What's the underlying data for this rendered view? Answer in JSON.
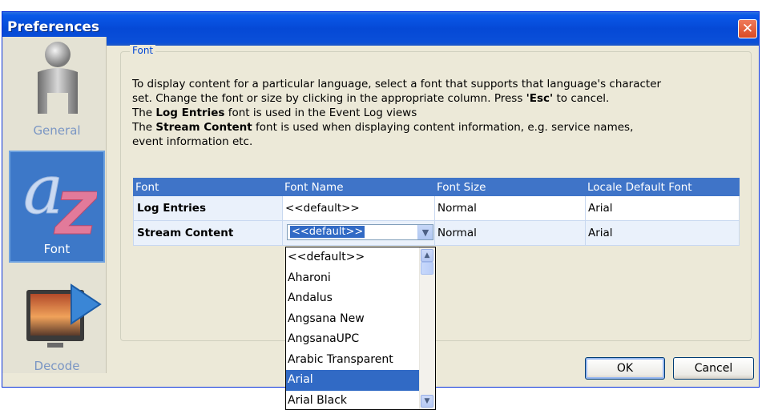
{
  "window": {
    "title": "Preferences",
    "close_glyph": "✕"
  },
  "sidebar": {
    "items": [
      {
        "label": "General",
        "icon": "person-icon",
        "selected": false
      },
      {
        "label": "Font",
        "icon": "font-az-icon",
        "selected": true
      },
      {
        "label": "Decode",
        "icon": "tv-play-icon",
        "selected": false
      }
    ]
  },
  "group": {
    "legend": "Font",
    "lines": [
      {
        "pre": "To display content for a particular language, select a font that supports that language's character",
        "bold": "",
        "post": ""
      },
      {
        "pre": "set. Change the font or size by clicking in the appropriate column. Press ",
        "bold": "'Esc'",
        "post": " to cancel."
      },
      {
        "pre": "The ",
        "bold": "Log Entries",
        "post": " font is used in the Event Log views"
      },
      {
        "pre": "The ",
        "bold": "Stream Content",
        "post": " font is used when displaying content information, e.g. service names,"
      },
      {
        "pre": "event information etc.",
        "bold": "",
        "post": ""
      }
    ]
  },
  "table": {
    "headers": [
      "Font",
      "Font Name",
      "Font Size",
      "Locale Default Font"
    ],
    "rows": [
      {
        "font": "Log Entries",
        "name": "<<default>>",
        "size": "Normal",
        "locale": "Arial"
      },
      {
        "font": "Stream Content",
        "name": "<<default>>",
        "size": "Normal",
        "locale": "Arial"
      }
    ]
  },
  "dropdown": {
    "selected_value": "<<default>>",
    "options": [
      "<<default>>",
      "Aharoni",
      "Andalus",
      "Angsana New",
      "AngsanaUPC",
      "Arabic Transparent",
      "Arial",
      "Arial Black"
    ],
    "highlighted": "Arial"
  },
  "buttons": {
    "ok": "OK",
    "cancel": "Cancel"
  },
  "colors": {
    "titlebar": "#0549d6",
    "header_bg": "#3f74c8",
    "selection": "#316ac5",
    "legend": "#0046d5"
  }
}
